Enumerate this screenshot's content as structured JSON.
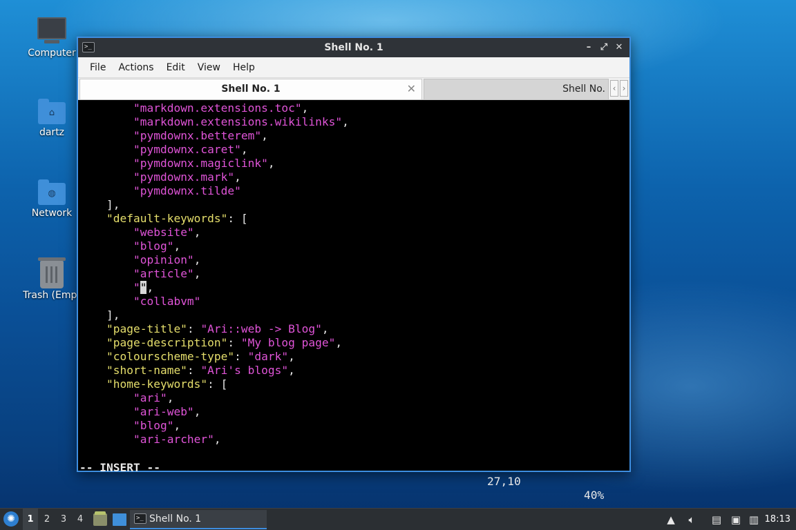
{
  "desktop": {
    "icons": [
      {
        "label": "Computer",
        "icon": "monitor-icon"
      },
      {
        "label": "dartz",
        "icon": "home-folder-icon"
      },
      {
        "label": "Network",
        "icon": "network-folder-icon"
      },
      {
        "label": "Trash (Empt",
        "icon": "trash-icon"
      }
    ]
  },
  "window": {
    "title": "Shell No. 1",
    "menu": [
      "File",
      "Actions",
      "Edit",
      "View",
      "Help"
    ],
    "tabs": [
      {
        "label": "Shell No. 1",
        "active": true
      },
      {
        "label": "Shell No.",
        "active": false
      }
    ],
    "accent_color": "#3d8ee0"
  },
  "editor": {
    "lines": [
      {
        "indent": "        ",
        "parts": [
          {
            "t": "\"markdown.extensions.toc\"",
            "c": "s"
          },
          {
            "t": ",",
            "c": "p"
          }
        ]
      },
      {
        "indent": "        ",
        "parts": [
          {
            "t": "\"markdown.extensions.wikilinks\"",
            "c": "s"
          },
          {
            "t": ",",
            "c": "p"
          }
        ]
      },
      {
        "indent": "        ",
        "parts": [
          {
            "t": "\"pymdownx.betterem\"",
            "c": "s"
          },
          {
            "t": ",",
            "c": "p"
          }
        ]
      },
      {
        "indent": "        ",
        "parts": [
          {
            "t": "\"pymdownx.caret\"",
            "c": "s"
          },
          {
            "t": ",",
            "c": "p"
          }
        ]
      },
      {
        "indent": "        ",
        "parts": [
          {
            "t": "\"pymdownx.magiclink\"",
            "c": "s"
          },
          {
            "t": ",",
            "c": "p"
          }
        ]
      },
      {
        "indent": "        ",
        "parts": [
          {
            "t": "\"pymdownx.mark\"",
            "c": "s"
          },
          {
            "t": ",",
            "c": "p"
          }
        ]
      },
      {
        "indent": "        ",
        "parts": [
          {
            "t": "\"pymdownx.tilde\"",
            "c": "s"
          }
        ]
      },
      {
        "indent": "    ",
        "parts": [
          {
            "t": "],",
            "c": "p"
          }
        ]
      },
      {
        "indent": "    ",
        "parts": [
          {
            "t": "\"default-keywords\"",
            "c": "k"
          },
          {
            "t": ": [",
            "c": "p"
          }
        ]
      },
      {
        "indent": "        ",
        "parts": [
          {
            "t": "\"website\"",
            "c": "s"
          },
          {
            "t": ",",
            "c": "p"
          }
        ]
      },
      {
        "indent": "        ",
        "parts": [
          {
            "t": "\"blog\"",
            "c": "s"
          },
          {
            "t": ",",
            "c": "p"
          }
        ]
      },
      {
        "indent": "        ",
        "parts": [
          {
            "t": "\"opinion\"",
            "c": "s"
          },
          {
            "t": ",",
            "c": "p"
          }
        ]
      },
      {
        "indent": "        ",
        "parts": [
          {
            "t": "\"article\"",
            "c": "s"
          },
          {
            "t": ",",
            "c": "p"
          }
        ]
      },
      {
        "indent": "        ",
        "parts": [
          {
            "t": "\"",
            "c": "s"
          },
          {
            "t": "\"",
            "c": "cursor"
          },
          {
            "t": ",",
            "c": "p"
          }
        ]
      },
      {
        "indent": "        ",
        "parts": [
          {
            "t": "\"collabvm\"",
            "c": "s"
          }
        ]
      },
      {
        "indent": "    ",
        "parts": [
          {
            "t": "],",
            "c": "p"
          }
        ]
      },
      {
        "indent": "    ",
        "parts": [
          {
            "t": "\"page-title\"",
            "c": "k"
          },
          {
            "t": ": ",
            "c": "p"
          },
          {
            "t": "\"Ari::web -> Blog\"",
            "c": "s"
          },
          {
            "t": ",",
            "c": "p"
          }
        ]
      },
      {
        "indent": "    ",
        "parts": [
          {
            "t": "\"page-description\"",
            "c": "k"
          },
          {
            "t": ": ",
            "c": "p"
          },
          {
            "t": "\"My blog page\"",
            "c": "s"
          },
          {
            "t": ",",
            "c": "p"
          }
        ]
      },
      {
        "indent": "    ",
        "parts": [
          {
            "t": "\"colourscheme-type\"",
            "c": "k"
          },
          {
            "t": ": ",
            "c": "p"
          },
          {
            "t": "\"dark\"",
            "c": "s"
          },
          {
            "t": ",",
            "c": "p"
          }
        ]
      },
      {
        "indent": "    ",
        "parts": [
          {
            "t": "\"short-name\"",
            "c": "k"
          },
          {
            "t": ": ",
            "c": "p"
          },
          {
            "t": "\"Ari's blogs\"",
            "c": "s"
          },
          {
            "t": ",",
            "c": "p"
          }
        ]
      },
      {
        "indent": "    ",
        "parts": [
          {
            "t": "\"home-keywords\"",
            "c": "k"
          },
          {
            "t": ": [",
            "c": "p"
          }
        ]
      },
      {
        "indent": "        ",
        "parts": [
          {
            "t": "\"ari\"",
            "c": "s"
          },
          {
            "t": ",",
            "c": "p"
          }
        ]
      },
      {
        "indent": "        ",
        "parts": [
          {
            "t": "\"ari-web\"",
            "c": "s"
          },
          {
            "t": ",",
            "c": "p"
          }
        ]
      },
      {
        "indent": "        ",
        "parts": [
          {
            "t": "\"blog\"",
            "c": "s"
          },
          {
            "t": ",",
            "c": "p"
          }
        ]
      },
      {
        "indent": "        ",
        "parts": [
          {
            "t": "\"ari-archer\"",
            "c": "s"
          },
          {
            "t": ",",
            "c": "p"
          }
        ]
      }
    ],
    "status": {
      "mode": "-- INSERT --",
      "position": "27,10",
      "percent": "40%"
    },
    "colors": {
      "key": "#e6df6c",
      "string": "#e054d8",
      "text": "#e8e8e8"
    }
  },
  "taskbar": {
    "workspaces": [
      "1",
      "2",
      "3",
      "4"
    ],
    "active_workspace": "1",
    "task": "Shell No. 1",
    "tray_icons": [
      "updates-icon",
      "volume-icon",
      "clipboard-icon",
      "network-icon",
      "notification-icon"
    ],
    "clock": "18:13"
  }
}
